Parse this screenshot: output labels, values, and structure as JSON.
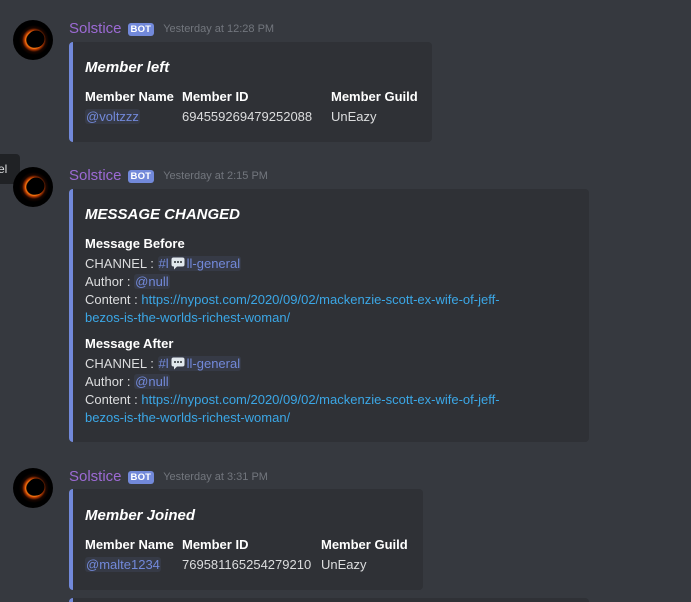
{
  "side_tab": {
    "label": "el"
  },
  "messages": [
    {
      "username": "Solstice",
      "bot_tag": "BOT",
      "timestamp": "Yesterday at 12:28 PM",
      "embed": {
        "title": "Member left",
        "fields": [
          {
            "name": "Member Name",
            "value": "@voltzzz"
          },
          {
            "name": "Member ID",
            "value": "694559269479252088"
          },
          {
            "name": "Member Guild",
            "value": "UnEazy"
          }
        ]
      }
    },
    {
      "username": "Solstice",
      "bot_tag": "BOT",
      "timestamp": "Yesterday at 2:15 PM",
      "embed": {
        "title": "MESSAGE CHANGED",
        "before": {
          "heading": "Message Before",
          "channel_label": "CHANNEL :",
          "channel_prefix": "#l",
          "channel_suffix": "ll-general",
          "author_label": "Author :",
          "author": "@null",
          "content_label": "Content :",
          "content_line1": "https://nypost.com/2020/09/02/mackenzie-scott-ex-wife-of-jeff-",
          "content_line2": "bezos-is-the-worlds-richest-woman/"
        },
        "after": {
          "heading": "Message After",
          "channel_label": "CHANNEL :",
          "channel_prefix": "#l",
          "channel_suffix": "ll-general",
          "author_label": "Author :",
          "author": "@null",
          "content_label": "Content :",
          "content_line1": "https://nypost.com/2020/09/02/mackenzie-scott-ex-wife-of-jeff-",
          "content_line2": "bezos-is-the-worlds-richest-woman/"
        }
      }
    },
    {
      "username": "Solstice",
      "bot_tag": "BOT",
      "timestamp": "Yesterday at 3:31 PM",
      "embed": {
        "title": "Member Joined",
        "fields": [
          {
            "name": "Member Name",
            "value": "@malte1234"
          },
          {
            "name": "Member ID",
            "value": "769581165254279210"
          },
          {
            "name": "Member Guild",
            "value": "UnEazy"
          }
        ]
      }
    }
  ],
  "colors": {
    "background": "#36393f",
    "embed_background": "#2f3136",
    "embed_border": "#7289da",
    "username": "#9c6ad4",
    "link": "#3ba7e6",
    "mention": "#7289da"
  },
  "icons": {
    "avatar": "solar-eclipse-avatar",
    "channel_emoji": "speech-bubble-icon"
  }
}
